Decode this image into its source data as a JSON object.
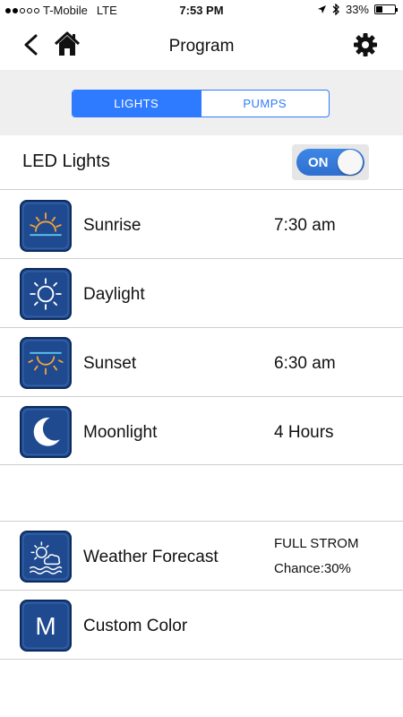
{
  "status_bar": {
    "carrier": "T-Mobile",
    "network": "LTE",
    "time": "7:53 PM",
    "battery_percent": "33%",
    "battery_level": 0.33,
    "signal_dots_filled": 2,
    "signal_dots_total": 5
  },
  "nav": {
    "title": "Program",
    "back_icon": "chevron-left-icon",
    "home_icon": "home-icon",
    "settings_icon": "gear-icon"
  },
  "segments": [
    {
      "label": "LIGHTS",
      "active": true
    },
    {
      "label": "PUMPS",
      "active": false
    }
  ],
  "led": {
    "label": "LED Lights",
    "toggle_label": "ON",
    "on": true
  },
  "items": [
    {
      "label": "Sunrise",
      "value": "7:30 am",
      "icon": "sunrise-icon"
    },
    {
      "label": "Daylight",
      "value": "",
      "icon": "sun-icon"
    },
    {
      "label": "Sunset",
      "value": "6:30 am",
      "icon": "sunset-icon"
    },
    {
      "label": "Moonlight",
      "value": "4 Hours",
      "icon": "moon-icon"
    }
  ],
  "extras": [
    {
      "label": "Weather Forecast",
      "line1": "FULL STROM",
      "line2": "Chance:30%",
      "icon": "weather-icon"
    },
    {
      "label": "Custom Color",
      "icon": "letter-m-icon",
      "icon_text": "M"
    }
  ],
  "colors": {
    "accent": "#2f7bff",
    "icon_bg": "#1f4a8f",
    "sun_orange": "#f0a23a",
    "icon_line": "#ffffff",
    "divider": "#cfcfcf",
    "segment_bg": "#efefef"
  }
}
